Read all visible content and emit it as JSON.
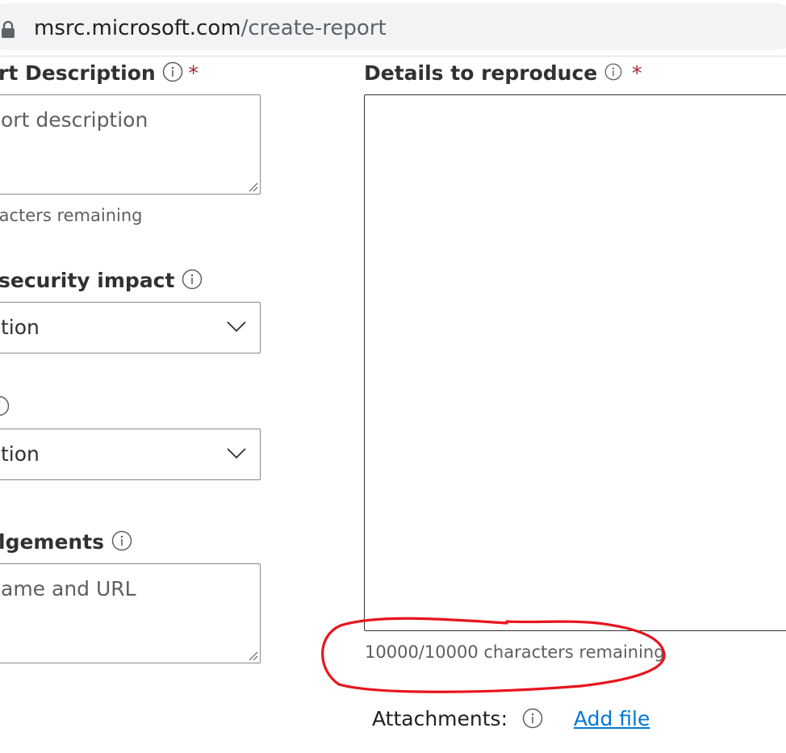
{
  "browser": {
    "url_host": "msrc.microsoft.com",
    "url_path": "/create-report"
  },
  "form": {
    "report_description": {
      "label": "rt Description",
      "required_mark": "*",
      "placeholder": "ort description",
      "helper": "racters remaining"
    },
    "security_impact": {
      "label": "security impact",
      "selected": "tion"
    },
    "second_dropdown": {
      "selected": "tion"
    },
    "acknowledgements": {
      "label": "lgements",
      "placeholder": "ame and URL"
    },
    "details": {
      "label": "Details to reproduce",
      "required_mark": "*",
      "helper": "10000/10000 characters remaining"
    },
    "attachments": {
      "label": "Attachments:",
      "add_file": "Add file"
    }
  },
  "colors": {
    "required": "#a4262c",
    "link": "#0078d4",
    "annotation": "#e8141e"
  }
}
